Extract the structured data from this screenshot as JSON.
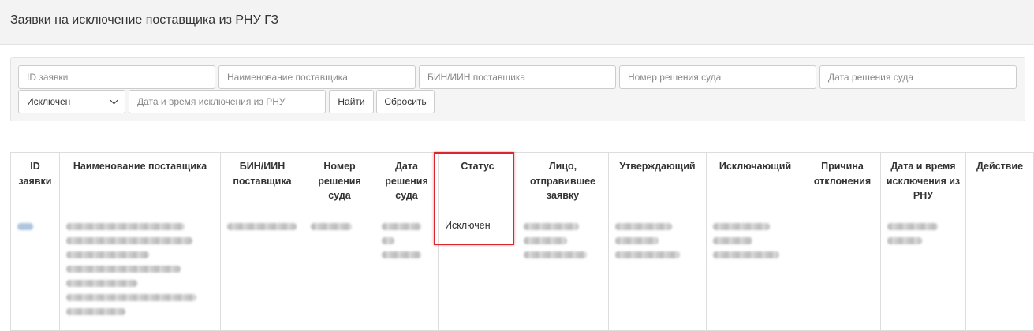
{
  "page": {
    "title": "Заявки на исключение поставщика из РНУ ГЗ"
  },
  "filters": {
    "id_placeholder": "ID заявки",
    "supplier_name_placeholder": "Наименование поставщика",
    "bin_placeholder": "БИН/ИИН поставщика",
    "court_decision_number_placeholder": "Номер решения суда",
    "court_decision_date_placeholder": "Дата решения суда",
    "status_selected": "Исключен",
    "exclusion_datetime_placeholder": "Дата и время исключения из РНУ",
    "find_label": "Найти",
    "reset_label": "Сбросить"
  },
  "table": {
    "columns": [
      "ID заявки",
      "Наименование поставщика",
      "БИН/ИИН поставщика",
      "Номер решения суда",
      "Дата решения суда",
      "Статус",
      "Лицо, отправившее заявку",
      "Утверждающий",
      "Исключающий",
      "Причина отклонения",
      "Дата и время исключения из РНУ",
      "Действие"
    ],
    "rows": [
      {
        "status": "Исключен"
      }
    ]
  },
  "colors": {
    "highlight": "#d9272e",
    "header_bg": "#f3f3f3",
    "panel_bg": "#f5f5f5"
  }
}
